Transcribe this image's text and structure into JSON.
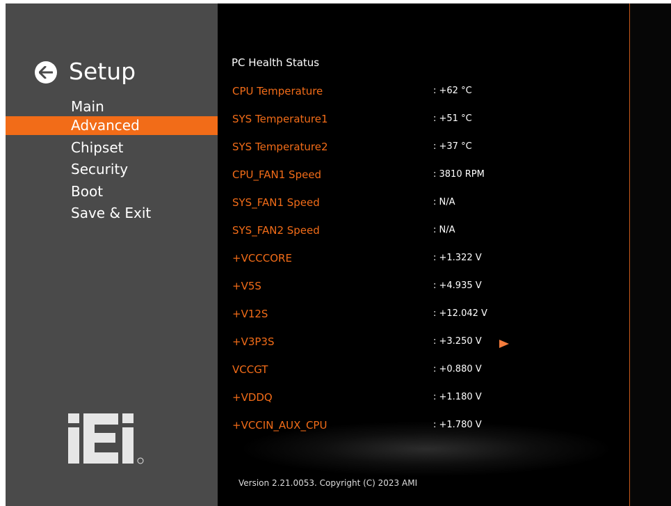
{
  "sidebar": {
    "title": "Setup",
    "back_icon": "arrow-left-icon",
    "items": [
      {
        "label": "Main"
      },
      {
        "label": "Advanced",
        "active": true
      },
      {
        "label": "Chipset"
      },
      {
        "label": "Security"
      },
      {
        "label": "Boot"
      },
      {
        "label": "Save & Exit"
      }
    ],
    "logo_text": "iEi",
    "logo_mark": "®"
  },
  "main": {
    "section_title": "PC Health Status",
    "rows": [
      {
        "label": "CPU Temperature",
        "value": ": +62 °C"
      },
      {
        "label": "SYS Temperature1",
        "value": ": +51 °C"
      },
      {
        "label": "SYS Temperature2",
        "value": ": +37 °C"
      },
      {
        "label": "CPU_FAN1 Speed",
        "value": ": 3810 RPM"
      },
      {
        "label": "SYS_FAN1 Speed",
        "value": ": N/A"
      },
      {
        "label": "SYS_FAN2 Speed",
        "value": ": N/A"
      },
      {
        "label": "+VCCCORE",
        "value": ": +1.322 V"
      },
      {
        "label": "+V5S",
        "value": ": +4.935 V"
      },
      {
        "label": "+V12S",
        "value": ": +12.042 V"
      },
      {
        "label": "+V3P3S",
        "value": ": +3.250 V"
      },
      {
        "label": "VCCGT",
        "value": ": +0.880 V"
      },
      {
        "label": "+VDDQ",
        "value": ": +1.180 V"
      },
      {
        "label": "+VCCIN_AUX_CPU",
        "value": ": +1.780 V"
      }
    ],
    "version": "Version 2.21.0053. Copyright (C) 2023 AMI"
  },
  "colors": {
    "accent": "#f26c18",
    "sidebar_bg": "#4a4a4a",
    "main_bg": "#000000"
  }
}
